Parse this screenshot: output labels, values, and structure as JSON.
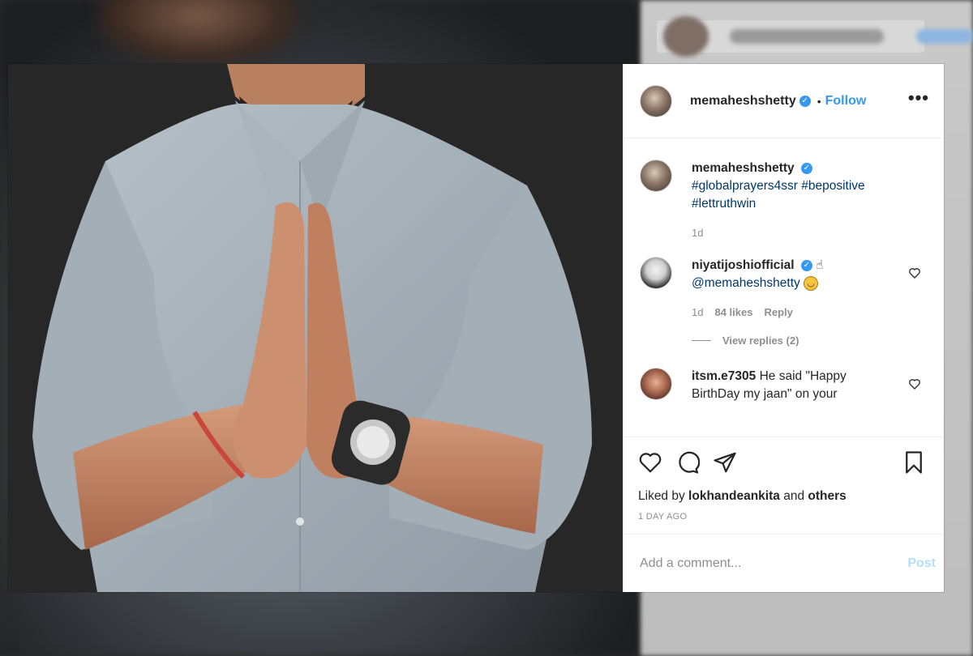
{
  "post": {
    "author": {
      "username": "memaheshshetty",
      "verified": true
    },
    "header": {
      "dot": "•",
      "follow_label": "Follow",
      "more_label": "•••"
    },
    "caption": {
      "username": "memaheshshetty",
      "line1": "#globalprayers4ssr #bepositive",
      "line2": "#lettruthwin",
      "time": "1d"
    },
    "comments": [
      {
        "username": "niyatijoshiofficial",
        "mention": "@memaheshshetty",
        "time": "1d",
        "likes": "84 likes",
        "reply_label": "Reply",
        "view_replies": "View replies (2)"
      },
      {
        "username": "itsm.e7305",
        "text": "He said \"Happy BirthDay my jaan\" on your"
      }
    ],
    "liked_by": {
      "prefix": "Liked by",
      "user": "lokhandeankita",
      "and": "and",
      "others": "others"
    },
    "timestamp": "1 DAY AGO",
    "comment_input": {
      "placeholder": "Add a comment..."
    },
    "post_button": "Post"
  },
  "icons": {
    "like": "heart-icon",
    "comment": "comment-bubble-icon",
    "share": "paper-plane-icon",
    "save": "bookmark-icon",
    "verified": "verified-badge-icon",
    "more": "ellipsis-icon"
  },
  "colors": {
    "link_blue": "#3897f0",
    "tag_blue": "#00376b",
    "muted": "#8e8e8e",
    "post_disabled": "#b2dffc"
  }
}
